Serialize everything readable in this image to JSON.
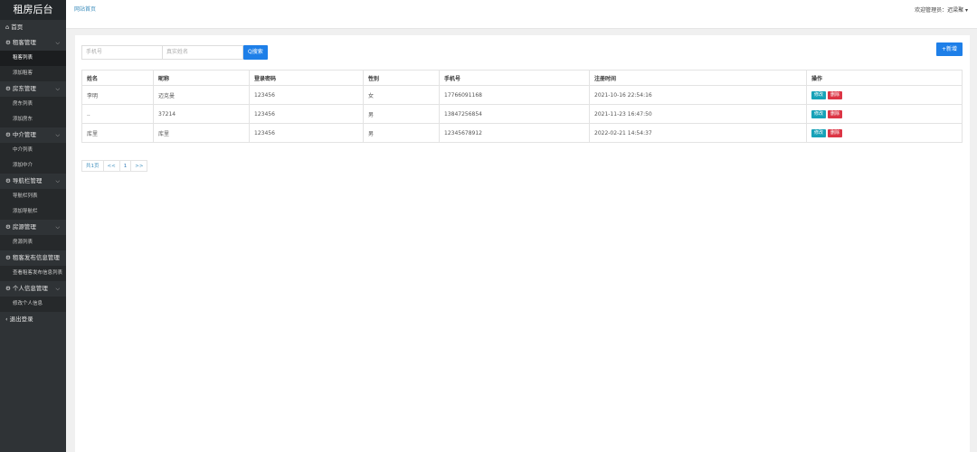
{
  "sidebar": {
    "brand": "租房后台",
    "items": [
      {
        "type": "top",
        "icon": "home-icon",
        "label": "⌂ 首页",
        "chev": ""
      },
      {
        "type": "top",
        "icon": "gear-icon",
        "label": "⚙ 租客管理",
        "chev": "⌵"
      },
      {
        "type": "sub",
        "label": "租客列表",
        "active": true
      },
      {
        "type": "sub",
        "label": "添加租客"
      },
      {
        "type": "top",
        "icon": "gear-icon",
        "label": "⚙ 房东管理",
        "chev": "⌵"
      },
      {
        "type": "sub",
        "label": "房东列表"
      },
      {
        "type": "sub",
        "label": "添加房东"
      },
      {
        "type": "top",
        "icon": "gear-icon",
        "label": "⚙ 中介管理",
        "chev": "⌵"
      },
      {
        "type": "sub",
        "label": "中介列表"
      },
      {
        "type": "sub",
        "label": "添加中介"
      },
      {
        "type": "top",
        "icon": "gear-icon",
        "label": "⚙ 导航栏管理",
        "chev": "⌵"
      },
      {
        "type": "sub",
        "label": "导航栏列表"
      },
      {
        "type": "sub",
        "label": "添加导航栏"
      },
      {
        "type": "top",
        "icon": "gear-icon",
        "label": "⚙ 房源管理",
        "chev": "⌵"
      },
      {
        "type": "sub",
        "label": "房源列表"
      },
      {
        "type": "top",
        "icon": "gear-icon",
        "label": "⚙ 租客发布信息管理",
        "chev": "⌵"
      },
      {
        "type": "sub",
        "label": "查看租客发布信息列表"
      },
      {
        "type": "top",
        "icon": "gear-icon",
        "label": "⚙ 个人信息管理",
        "chev": "⌵"
      },
      {
        "type": "sub",
        "label": "修改个人信息"
      },
      {
        "type": "top",
        "icon": "logout-icon",
        "label": "‹ 退出登录",
        "chev": ""
      }
    ]
  },
  "topbar": {
    "home_link": "网站首页",
    "welcome": "欢迎管理员：迟梁聚 ▾"
  },
  "search": {
    "phone_placeholder": "手机号",
    "name_placeholder": "真实姓名",
    "button": "Q搜索"
  },
  "add_button": "+新增",
  "table": {
    "headers": [
      "姓名",
      "昵称",
      "登录密码",
      "性别",
      "手机号",
      "注册时间",
      "操作"
    ],
    "rows": [
      [
        "李明",
        "迈克曼",
        "123456",
        "女",
        "17766091168",
        "2021-10-16 22:54:16"
      ],
      [
        "..",
        "37214",
        "123456",
        "男",
        "13847256854",
        "2021-11-23 16:47:50"
      ],
      [
        "库里",
        "库里",
        "123456",
        "男",
        "12345678912",
        "2022-02-21 14:54:37"
      ]
    ],
    "edit_label": "修改",
    "delete_label": "删除"
  },
  "pager": {
    "total": "共1页",
    "prev": "<<",
    "current": "1",
    "next": ">>"
  }
}
